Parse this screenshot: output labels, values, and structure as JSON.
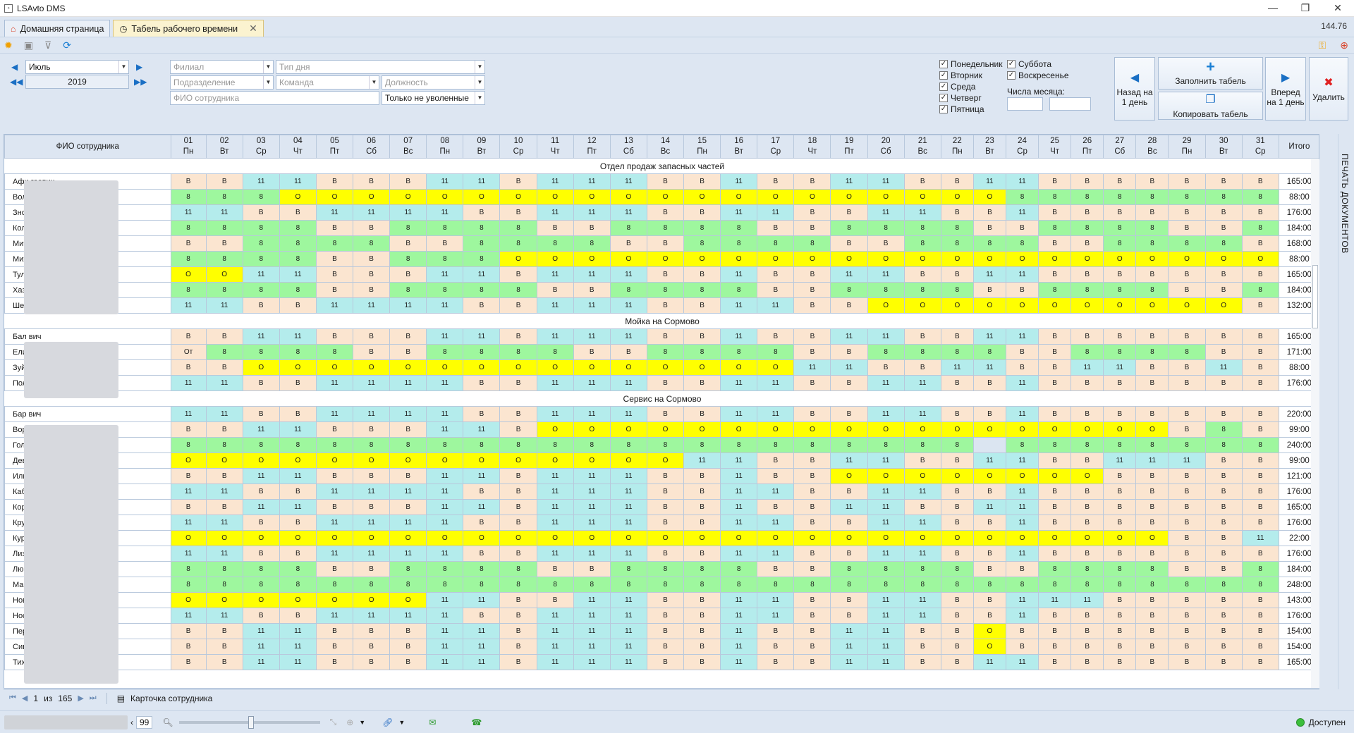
{
  "window": {
    "title": "LSAvto DMS"
  },
  "version": "144.76",
  "tabs": [
    {
      "label": "Домашняя страница"
    },
    {
      "label": "Табель рабочего времени"
    }
  ],
  "filters": {
    "month": "Июль",
    "year": "2019",
    "branch_placeholder": "Филиал",
    "daytype_placeholder": "Тип дня",
    "division_placeholder": "Подразделение",
    "team_placeholder": "Команда",
    "position_placeholder": "Должность",
    "employee_placeholder": "ФИО сотрудника",
    "dismissed_value": "Только не уволенные",
    "days_label": "Числа месяца:",
    "weekdays": [
      "Понедельник",
      "Вторник",
      "Среда",
      "Четверг",
      "Пятница",
      "Суббота",
      "Воскресенье"
    ]
  },
  "buttons": {
    "back": "Назад на 1 день",
    "fill": "Заполнить табель",
    "copy": "Копировать табель",
    "forward": "Вперед на 1 день",
    "delete": "Удалить"
  },
  "grid": {
    "col_name": "ФИО сотрудника",
    "col_total": "Итого",
    "days": [
      "01",
      "02",
      "03",
      "04",
      "05",
      "06",
      "07",
      "08",
      "09",
      "10",
      "11",
      "12",
      "13",
      "14",
      "15",
      "16",
      "17",
      "18",
      "19",
      "20",
      "21",
      "22",
      "23",
      "24",
      "25",
      "26",
      "27",
      "28",
      "29",
      "30",
      "31"
    ],
    "dow": [
      "Пн",
      "Вт",
      "Ср",
      "Чт",
      "Пт",
      "Сб",
      "Вс",
      "Пн",
      "Вт",
      "Ср",
      "Чт",
      "Пт",
      "Сб",
      "Вс",
      "Пн",
      "Вт",
      "Ср",
      "Чт",
      "Пт",
      "Сб",
      "Вс",
      "Пн",
      "Вт",
      "Ср",
      "Чт",
      "Пт",
      "Сб",
      "Вс",
      "Пн",
      "Вт",
      "Ср"
    ],
    "groups": [
      {
        "title": "Отдел продаж запасных частей",
        "rows": [
          {
            "name": "Афи                          геевич",
            "total": "165:00",
            "c": "BB1111BBB1111B111111BB11BB1111BB1111B"
          },
          {
            "name": "Вол                           вич",
            "total": "88:00",
            "c": "888OOOOOOOOOOOOOOOOOOOO88888888888"
          },
          {
            "name": "Зно                           еевич",
            "total": "176:00",
            "c": "1111BB11111111BB111111BB1111BB1111BB11"
          },
          {
            "name": "Кол",
            "total": "184:00",
            "c": "8888BB8888BB8888BB8888BB8888BB888"
          },
          {
            "name": "Мит                           дрович",
            "total": "168:00",
            "c": "BB8888BB8888BB8888BB8888BB8888BB88"
          },
          {
            "name": "Мих                           рович",
            "total": "88:00",
            "c": "8888BB888OOOOOOOOOOOOOOOOOOOOOO"
          },
          {
            "name": "Тул                           ва",
            "total": "165:00",
            "c": "OO1111BBB1111B111111BB11BB1111BB1111B"
          },
          {
            "name": "Хаз",
            "total": "184:00",
            "c": "8888BB8888BB8888BB8888BB8888BB888"
          },
          {
            "name": "Шеб                           лаевич",
            "total": "132:00",
            "c": "1111BB11111111BB111111BB1111BBOOOOOOOOOOO"
          }
        ]
      },
      {
        "title": "Мойка на Сормово",
        "rows": [
          {
            "name": "Бал                           вич",
            "total": "165:00",
            "c": "BB1111BBB1111B111111BB11BB1111BB1111B"
          },
          {
            "name": "Ели                           вна",
            "total": "171:00",
            "c": "Ot8888BB8888BB8888BB8888BB8888BB888"
          },
          {
            "name": "Зуй                           рович",
            "total": "88:00",
            "c": "BBOOOOOOOOOOOOOOO1111BB1111BB1111BB11"
          },
          {
            "name": "Пол                           евич",
            "total": "176:00",
            "c": "1111BB11111111BB111111BB1111BB1111BB11"
          }
        ]
      },
      {
        "title": "Сервис на Сормово",
        "rows": [
          {
            "name": "Бар                           вич",
            "total": "220:00",
            "c": "1111BB11111111BB111111BB1111BB1111BB11"
          },
          {
            "name": "Вор                           рович",
            "total": "99:00",
            "c": "BB1111BBB1111BOOOOOOOOOOOOOOOOOOB8"
          },
          {
            "name": "Гол",
            "total": "240:00",
            "c": "8888888888888888888888E888888888"
          },
          {
            "name": "Дев                           ерович",
            "total": "99:00",
            "c": "OOOOOOOOOOOOOO1111BB1111BB1111BB111111"
          },
          {
            "name": "Иль                           ич",
            "total": "121:00",
            "c": "BB1111BBB1111B111111BB11BBOOOOOOOO"
          },
          {
            "name": "Каб                           ч",
            "total": "176:00",
            "c": "1111BB11111111BB111111BB1111BB1111BB11"
          },
          {
            "name": "Кор                           ч",
            "total": "165:00",
            "c": "BB1111BBB1111B111111BB11BB1111BB1111B"
          },
          {
            "name": "Кру                           ч",
            "total": "176:00",
            "c": "1111BB11111111BB111111BB1111BB1111BB11"
          },
          {
            "name": "Кур                           дрович",
            "total": "22:00",
            "c": "OOOOOOOOOOOOOOOOOOOOOOOOOOOOBB11"
          },
          {
            "name": "Лиз                           инович",
            "total": "176:00",
            "c": "1111BB11111111BB111111BB1111BB1111BB11"
          },
          {
            "name": "Люб                           ч",
            "total": "184:00",
            "c": "8888BB8888BB8888BB8888BB8888BB888"
          },
          {
            "name": "Мак                           ч",
            "total": "248:00",
            "c": "8888888888888888888888888888888"
          },
          {
            "name": "Нов                           кторович",
            "total": "143:00",
            "c": "OOOOOOO1111BB1111BB1111BB1111BB111111"
          },
          {
            "name": "Нос                           вич",
            "total": "176:00",
            "c": "1111BB11111111BB111111BB1111BB1111BB11"
          },
          {
            "name": "Пер                           еевич",
            "total": "154:00",
            "c": "BB1111BBB1111B111111BB11BB1111BBO"
          },
          {
            "name": "Сив                           дрович",
            "total": "154:00",
            "c": "BB1111BBB1111B111111BB11BB1111BBO"
          },
          {
            "name": "Тих                           вич",
            "total": "165:00",
            "c": "BB1111BBB1111B111111BB11BB1111BB1111B"
          }
        ]
      }
    ]
  },
  "pager": {
    "current": "1",
    "of": "из",
    "total": "165",
    "card": "Карточка сотрудника"
  },
  "status": {
    "zoom": "99",
    "online": "Доступен"
  },
  "side_panel": "ПЕЧАТЬ ДОКУМЕНТОВ"
}
